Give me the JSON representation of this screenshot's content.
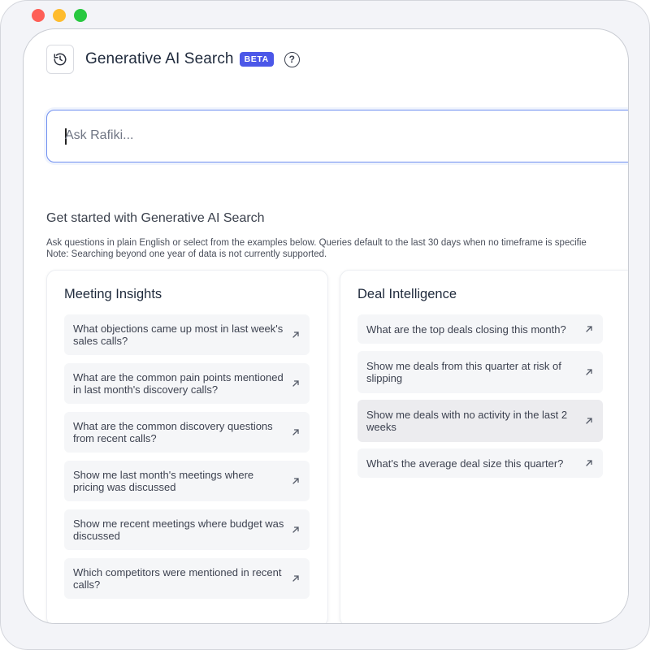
{
  "header": {
    "title": "Generative AI Search",
    "badge": "BETA",
    "help": "?"
  },
  "search": {
    "placeholder": "Ask Rafiki..."
  },
  "intro": {
    "title": "Get started with Generative AI Search",
    "line1": "Ask questions in plain English or select from the examples below. Queries default to the last 30 days when no timeframe is specifie",
    "line2": "Note: Searching beyond one year of data is not currently supported."
  },
  "cards": [
    {
      "title": "Meeting Insights",
      "prompts": [
        "What objections came up most in last week's sales calls?",
        "What are the common pain points mentioned in last month's discovery calls?",
        "What are the common discovery questions from recent calls?",
        "Show me last month's meetings where pricing was discussed",
        "Show me recent meetings where budget was discussed",
        "Which competitors were mentioned in recent calls?"
      ]
    },
    {
      "title": "Deal Intelligence",
      "prompts": [
        "What are the top deals closing this month?",
        "Show me deals from this quarter at risk of slipping",
        "Show me deals with no activity in the last 2 weeks",
        "What's the average deal size this quarter?"
      ]
    }
  ],
  "icons": {
    "history": "history-icon",
    "help": "question-circle-icon",
    "prompt_arrow": "arrow-up-right-icon"
  },
  "colors": {
    "accent": "#4b57e8",
    "focus_border": "#6f8ff0",
    "prompt_bg": "#f5f6f8"
  }
}
